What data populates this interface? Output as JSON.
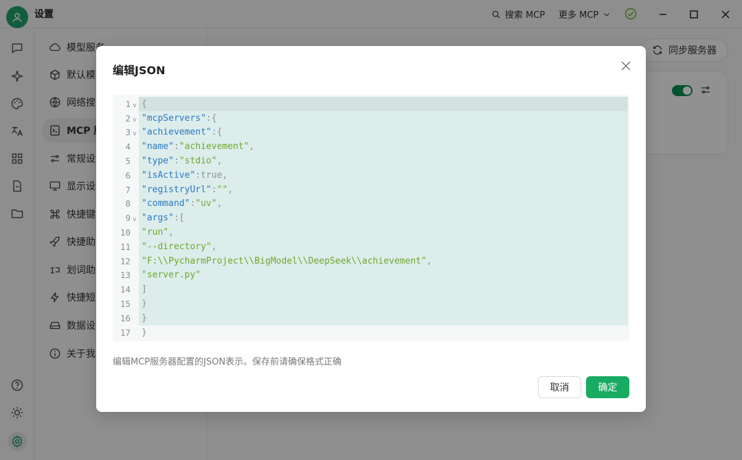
{
  "app": {
    "title": "设置",
    "search_label": "搜索 MCP",
    "more_label": "更多 MCP"
  },
  "nav": {
    "items": [
      {
        "label": "模型服务",
        "icon": "cloud-icon"
      },
      {
        "label": "默认模",
        "icon": "cube-icon"
      },
      {
        "label": "网络搜",
        "icon": "globe-icon"
      },
      {
        "label": "MCP 服",
        "icon": "mcp-icon"
      },
      {
        "label": "常规设",
        "icon": "sliders-icon"
      },
      {
        "label": "显示设",
        "icon": "monitor-icon"
      },
      {
        "label": "快捷键",
        "icon": "command-icon"
      },
      {
        "label": "快捷助",
        "icon": "rocket-icon"
      },
      {
        "label": "划词助",
        "icon": "highlight-icon"
      },
      {
        "label": "快捷短",
        "icon": "zap-icon"
      },
      {
        "label": "数据设",
        "icon": "drive-icon"
      },
      {
        "label": "关于我",
        "icon": "info-icon"
      }
    ]
  },
  "main": {
    "sync_label": "同步服务器"
  },
  "modal": {
    "title": "编辑JSON",
    "description": "编辑MCP服务器配置的JSON表示。保存前请确保格式正确",
    "cancel_label": "取消",
    "ok_label": "确定",
    "code_lines": [
      "{",
      "  \"mcpServers\": {",
      "    \"achievement\": {",
      "      \"name\": \"achievement\",",
      "      \"type\": \"stdio\",",
      "      \"isActive\": true,",
      "      \"registryUrl\": \"\",",
      "      \"command\": \"uv\",",
      "      \"args\": [",
      "        \"run\",",
      "        \"--directory\",",
      "        \"F:\\\\PycharmProject\\\\BigModel\\\\DeepSeek\\\\achievement\",",
      "        \"server.py\"",
      "      ]",
      "    }",
      "  }",
      "}"
    ],
    "fold_lines": [
      1,
      2,
      3,
      9
    ]
  },
  "colors": {
    "accent": "#18ab62",
    "json_key": "#2b78c5",
    "json_string": "#6ea82d",
    "code_bg": "#ddedeb"
  }
}
